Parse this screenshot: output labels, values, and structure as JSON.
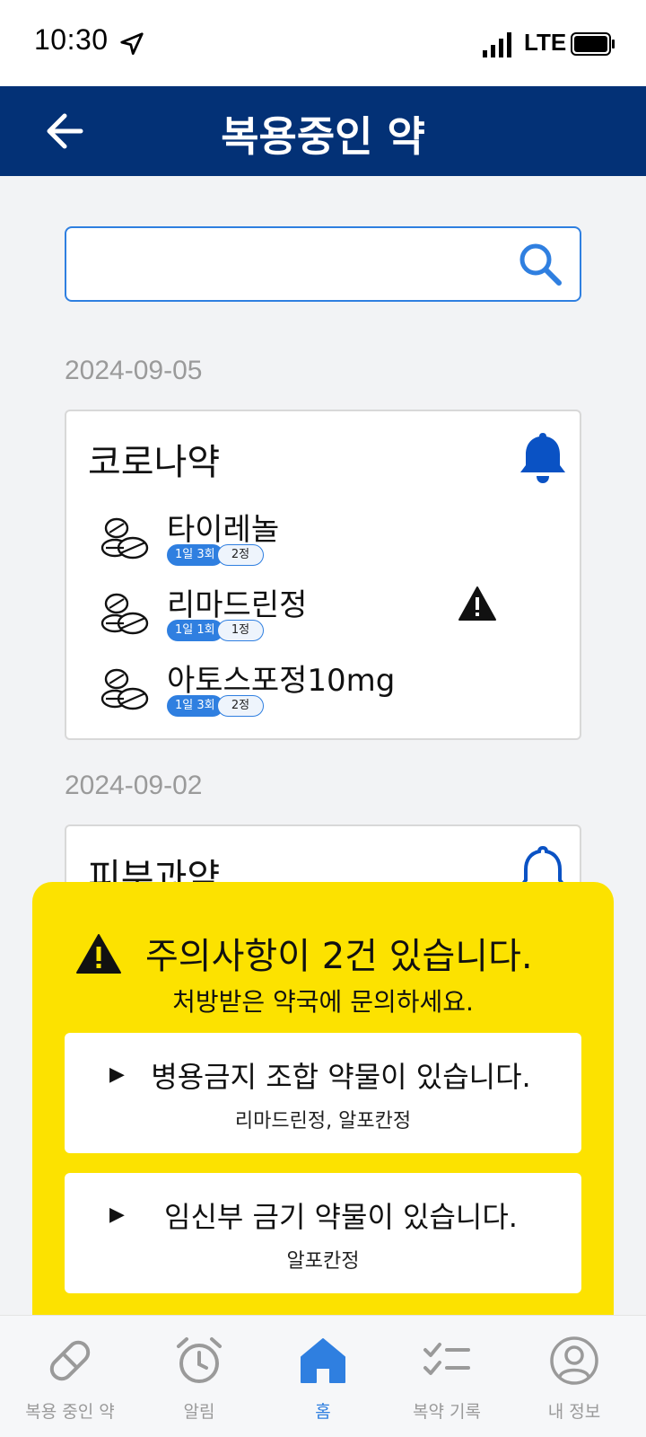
{
  "status_bar": {
    "time": "10:30",
    "network": "LTE"
  },
  "header": {
    "title": "복용중인 약"
  },
  "search": {
    "value": "",
    "placeholder": ""
  },
  "prescriptions": [
    {
      "date": "2024-09-05",
      "title": "코로나약",
      "medications": [
        {
          "name": "타이레놀",
          "frequency": "1일 3회",
          "quantity": "2정",
          "warning": false
        },
        {
          "name": "리마드린정",
          "frequency": "1일 1회",
          "quantity": "1정",
          "warning": true
        },
        {
          "name": "아토스포정10mg",
          "frequency": "1일 3회",
          "quantity": "2정",
          "warning": false
        }
      ]
    },
    {
      "date": "2024-09-02",
      "title": "피부과약",
      "medications": []
    }
  ],
  "alert": {
    "title": "주의사항이 2건 있습니다.",
    "subtitle": "처방받은 약국에 문의하세요.",
    "items": [
      {
        "title": "병용금지 조합 약물이 있습니다.",
        "detail": "리마드린정, 알포칸정"
      },
      {
        "title": "임신부 금기 약물이 있습니다.",
        "detail": "알포칸정"
      }
    ]
  },
  "nav": {
    "items": [
      {
        "label": "복용 중인 약",
        "icon": "pill-icon",
        "active": false
      },
      {
        "label": "알림",
        "icon": "alarm-clock-icon",
        "active": false
      },
      {
        "label": "홈",
        "icon": "home-icon",
        "active": true
      },
      {
        "label": "복약 기록",
        "icon": "checklist-icon",
        "active": false
      },
      {
        "label": "내 정보",
        "icon": "profile-icon",
        "active": false
      }
    ]
  },
  "colors": {
    "header_bg": "#033176",
    "accent": "#2f7fe0",
    "alert_bg": "#fce200"
  }
}
